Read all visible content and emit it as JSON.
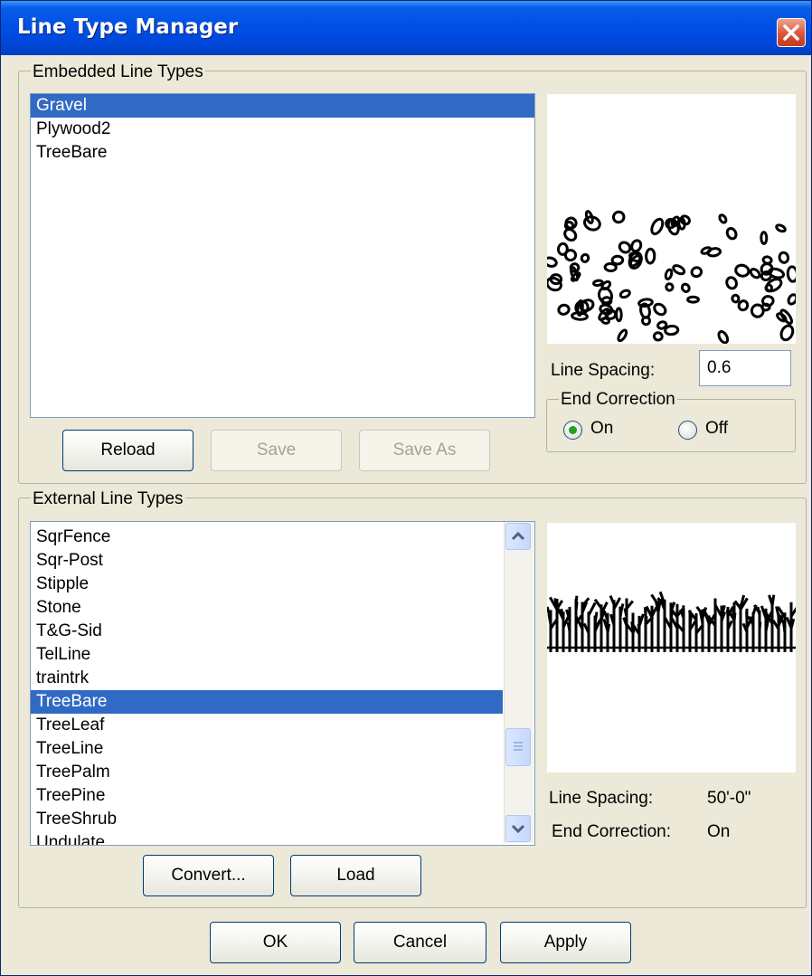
{
  "window": {
    "title": "Line Type Manager",
    "close_icon": "close-icon"
  },
  "embedded": {
    "legend": "Embedded Line Types",
    "items": [
      {
        "label": "Gravel",
        "selected": true
      },
      {
        "label": "Plywood2",
        "selected": false
      },
      {
        "label": "TreeBare",
        "selected": false
      }
    ],
    "buttons": {
      "reload": "Reload",
      "save": "Save",
      "save_as": "Save As"
    },
    "line_spacing_label": "Line Spacing:",
    "line_spacing_value": "0.6",
    "end_correction": {
      "legend": "End Correction",
      "on": "On",
      "off": "Off",
      "selected": "On"
    }
  },
  "external": {
    "legend": "External Line Types",
    "items": [
      {
        "label": "SqrFence",
        "selected": false
      },
      {
        "label": "Sqr-Post",
        "selected": false
      },
      {
        "label": "Stipple",
        "selected": false
      },
      {
        "label": "Stone",
        "selected": false
      },
      {
        "label": "T&G-Sid",
        "selected": false
      },
      {
        "label": "TelLine",
        "selected": false
      },
      {
        "label": "traintrk",
        "selected": false
      },
      {
        "label": "TreeBare",
        "selected": true
      },
      {
        "label": "TreeLeaf",
        "selected": false
      },
      {
        "label": "TreeLine",
        "selected": false
      },
      {
        "label": "TreePalm",
        "selected": false
      },
      {
        "label": "TreePine",
        "selected": false
      },
      {
        "label": "TreeShrub",
        "selected": false
      },
      {
        "label": "Undulate",
        "selected": false
      }
    ],
    "buttons": {
      "convert": "Convert...",
      "load": "Load"
    },
    "line_spacing_label": "Line Spacing:",
    "line_spacing_value": "50'-0\"",
    "end_correction_label": "End Correction:",
    "end_correction_value": "On"
  },
  "footer": {
    "ok": "OK",
    "cancel": "Cancel",
    "apply": "Apply"
  },
  "colors": {
    "selection": "#316ac5",
    "titlebar": "#0050e6",
    "dialog_bg": "#ece9d8"
  }
}
